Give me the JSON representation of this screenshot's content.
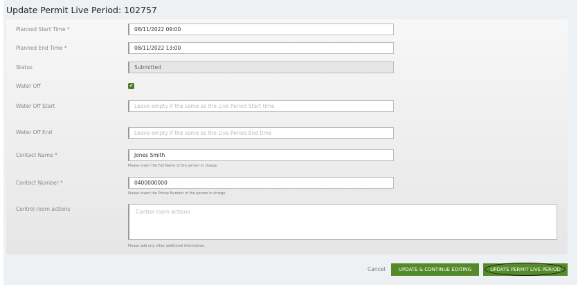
{
  "title": "Update Permit Live Period: 102757",
  "fields": {
    "start": {
      "label": "Planned Start Time *",
      "value": "08/11/2022 09:00"
    },
    "end": {
      "label": "Planned End Time *",
      "value": "08/11/2022 13:00"
    },
    "status": {
      "label": "Status",
      "value": "Submitted"
    },
    "water_off": {
      "label": "Water Off",
      "checked": true
    },
    "water_off_start": {
      "label": "Water Off Start",
      "placeholder": "Leave empty if the same as the Live Period Start time"
    },
    "water_off_end": {
      "label": "Water Off End",
      "placeholder": "Leave empty if the same as the Live Period End time"
    },
    "contact_name": {
      "label": "Contact Name *",
      "value": "Jones Smith",
      "hint": "Please insert the Full Name of the person in charge."
    },
    "contact_number": {
      "label": "Contact Number *",
      "value": "0400000000",
      "hint": "Please insert the Phone Number of the person in charge."
    },
    "control_room": {
      "label": "Control room actions",
      "placeholder": "Control room actions",
      "hint": "Please add any other additional information."
    }
  },
  "actions": {
    "cancel": "Cancel",
    "update_continue": "UPDATE & CONTINUE EDITING",
    "update_permit": "UPDATE PERMIT LIVE PERIOD"
  }
}
